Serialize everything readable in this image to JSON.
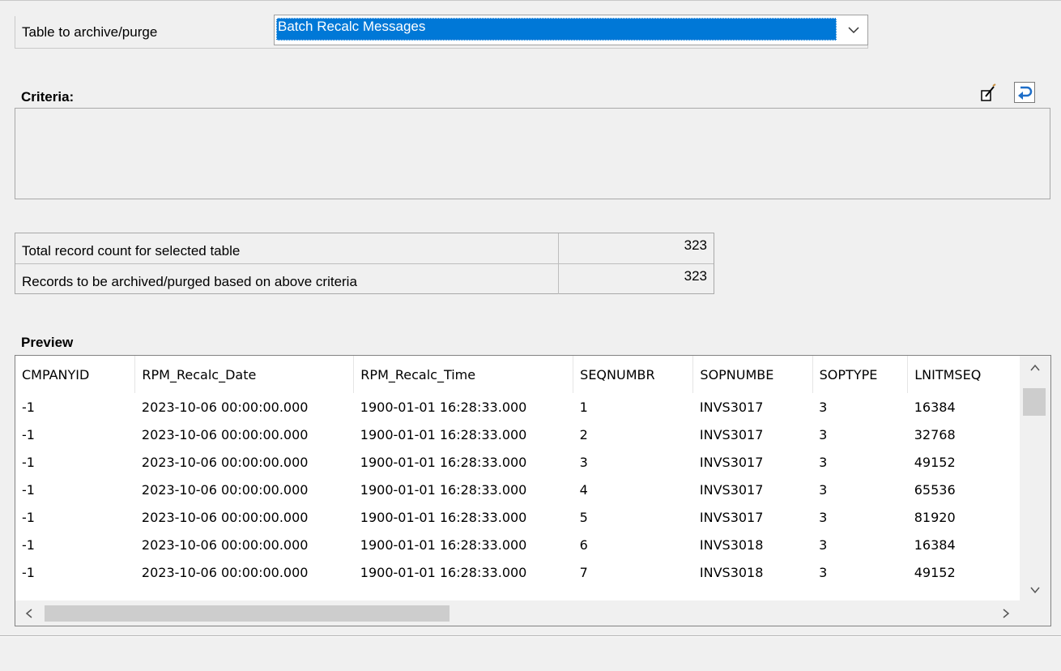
{
  "archive": {
    "label": "Table to archive/purge",
    "selected": "Batch Recalc Messages"
  },
  "criteria": {
    "title": "Criteria:",
    "text": ""
  },
  "counts": [
    {
      "label": "Total record count for selected table",
      "value": "323"
    },
    {
      "label": "Records to be archived/purged based on above criteria",
      "value": "323"
    }
  ],
  "preview": {
    "title": "Preview",
    "columns": [
      "CMPANYID",
      "RPM_Recalc_Date",
      "RPM_Recalc_Time",
      "SEQNUMBR",
      "SOPNUMBE",
      "SOPTYPE",
      "LNITMSEQ"
    ],
    "rows": [
      [
        "-1",
        "2023-10-06 00:00:00.000",
        "1900-01-01 16:28:33.000",
        "1",
        "INVS3017",
        "3",
        "16384"
      ],
      [
        "-1",
        "2023-10-06 00:00:00.000",
        "1900-01-01 16:28:33.000",
        "2",
        "INVS3017",
        "3",
        "32768"
      ],
      [
        "-1",
        "2023-10-06 00:00:00.000",
        "1900-01-01 16:28:33.000",
        "3",
        "INVS3017",
        "3",
        "49152"
      ],
      [
        "-1",
        "2023-10-06 00:00:00.000",
        "1900-01-01 16:28:33.000",
        "4",
        "INVS3017",
        "3",
        "65536"
      ],
      [
        "-1",
        "2023-10-06 00:00:00.000",
        "1900-01-01 16:28:33.000",
        "5",
        "INVS3017",
        "3",
        "81920"
      ],
      [
        "-1",
        "2023-10-06 00:00:00.000",
        "1900-01-01 16:28:33.000",
        "6",
        "INVS3018",
        "3",
        "16384"
      ],
      [
        "-1",
        "2023-10-06 00:00:00.000",
        "1900-01-01 16:28:33.000",
        "7",
        "INVS3018",
        "3",
        "49152"
      ]
    ]
  },
  "icons": {
    "edit": "edit-criteria-icon",
    "refresh": "refresh-icon"
  },
  "colors": {
    "selection": "#0078d7"
  }
}
